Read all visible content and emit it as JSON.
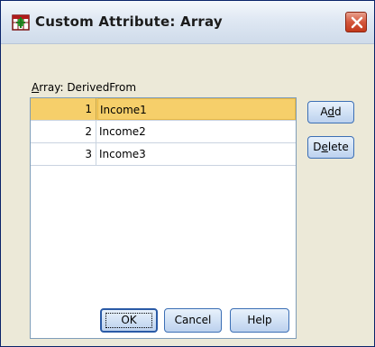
{
  "window": {
    "title": "Custom Attribute: Array",
    "icon": "spss-dialog-icon",
    "close_icon": "close-icon"
  },
  "array_label": {
    "prefix_accel": "A",
    "text": "rray: DerivedFrom"
  },
  "list": {
    "rows": [
      {
        "index": "1",
        "value": "Income1",
        "selected": true
      },
      {
        "index": "2",
        "value": "Income2",
        "selected": false
      },
      {
        "index": "3",
        "value": "Income3",
        "selected": false
      }
    ]
  },
  "buttons": {
    "add": {
      "pre": "A",
      "accel": "d",
      "post": "d"
    },
    "delete": {
      "pre": "D",
      "accel": "e",
      "post": "lete"
    },
    "ok": "OK",
    "cancel": "Cancel",
    "help": "Help"
  },
  "colors": {
    "selection": "#f6cf6a",
    "button_border": "#3c6fb5",
    "close_button": "#c2391b"
  }
}
